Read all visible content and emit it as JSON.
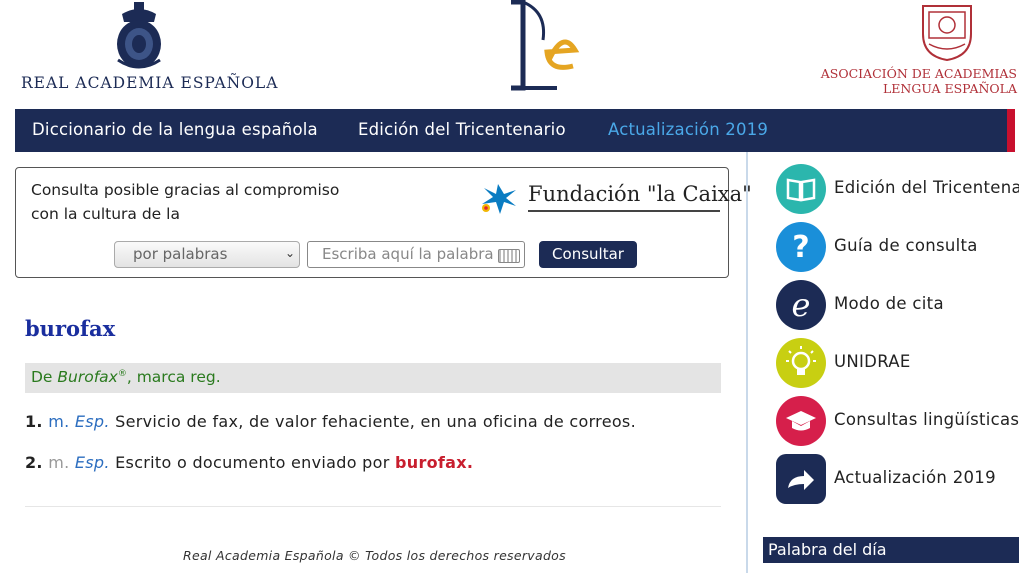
{
  "header": {
    "rae_name": "REAL ACADEMIA ESPAÑOLA",
    "asale_line1": "ASOCIACIÓN DE ACADEMIAS",
    "asale_line2": "LENGUA ESPAÑOLA"
  },
  "nav": {
    "items": [
      {
        "label": "Diccionario de la lengua española"
      },
      {
        "label": "Edición del Tricentenario"
      },
      {
        "label": "Actualización 2019"
      }
    ]
  },
  "search": {
    "sponsor_line1": "Consulta posible gracias al compromiso",
    "sponsor_line2": "con la cultura de la",
    "sponsor_name": "Fundación \"la Caixa\"",
    "mode_selected": "por palabras",
    "placeholder": "Escriba aquí la palabra",
    "button_label": "Consultar"
  },
  "entry": {
    "word": "burofax",
    "etymology": {
      "prefix": "De ",
      "origin": "Burofax",
      "reg_mark": "®",
      "suffix": ", marca reg."
    },
    "senses": [
      {
        "num": "1.",
        "gram": "m.",
        "mark": "Esp.",
        "text": " Servicio de fax, de valor fehaciente, en una oficina de correos.",
        "link": ""
      },
      {
        "num": "2.",
        "gram": "m.",
        "mark": "Esp.",
        "text": " Escrito o documento enviado por ",
        "link": "burofax."
      }
    ]
  },
  "footer": {
    "text": "Real Academia Española © Todos los derechos reservados"
  },
  "sidebar": {
    "items": [
      {
        "label": "Edición del Tricentenario",
        "icon": "book-icon",
        "color": "#2bb6ad"
      },
      {
        "label": "Guía de consulta",
        "icon": "question-icon",
        "color": "#1a8fd9"
      },
      {
        "label": "Modo de cita",
        "icon": "e-letter-icon",
        "color": "#1c2b55"
      },
      {
        "label": "UNIDRAE",
        "icon": "lightbulb-icon",
        "color": "#c8cf12"
      },
      {
        "label": "Consultas lingüísticas",
        "icon": "graduation-cap-icon",
        "color": "#d61f4b"
      },
      {
        "label": "Actualización 2019",
        "icon": "share-arrow-icon",
        "color": "#1c2b55"
      }
    ],
    "word_of_day_title": "Palabra del día"
  },
  "colors": {
    "navy": "#1c2b55",
    "accent_blue": "#4aa8e8",
    "link_red": "#c81e2e",
    "etym_green": "#2a7a1e"
  }
}
